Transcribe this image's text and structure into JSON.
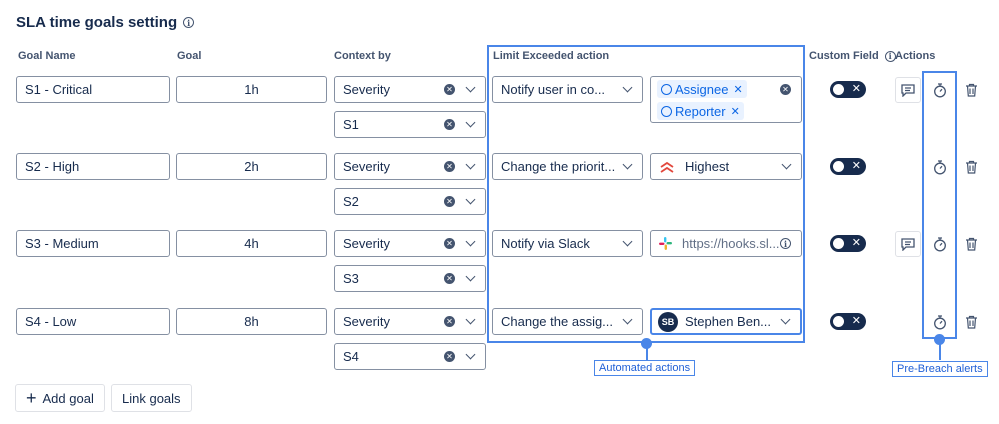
{
  "title": "SLA time goals setting",
  "headers": {
    "goal_name": "Goal Name",
    "goal": "Goal",
    "context_by": "Context by",
    "limit_action": "Limit Exceeded action",
    "custom_field": "Custom Field",
    "actions": "Actions"
  },
  "rows": [
    {
      "name": "S1 - Critical",
      "goal": "1h",
      "context": "Severity",
      "context_value": "S1",
      "action": "Notify user in co...",
      "target_tags": [
        "Assignee",
        "Reporter"
      ],
      "custom_field_on": false,
      "action_icons": [
        "comment-icon",
        "stopwatch-icon",
        "trash-icon"
      ]
    },
    {
      "name": "S2 - High",
      "goal": "2h",
      "context": "Severity",
      "context_value": "S2",
      "action": "Change the priorit...",
      "target": "Highest",
      "target_icon": "priority-highest-icon",
      "custom_field_on": false,
      "action_icons": [
        "stopwatch-icon",
        "trash-icon"
      ]
    },
    {
      "name": "S3 - Medium",
      "goal": "4h",
      "context": "Severity",
      "context_value": "S3",
      "action": "Notify via Slack",
      "target": "https://hooks.sl...",
      "target_icon": "slack-icon",
      "custom_field_on": false,
      "action_icons": [
        "comment-icon",
        "stopwatch-icon",
        "trash-icon"
      ]
    },
    {
      "name": "S4 - Low",
      "goal": "8h",
      "context": "Severity",
      "context_value": "S4",
      "action": "Change the assig...",
      "target": "Stephen Ben...",
      "target_avatar": "SB",
      "custom_field_on": false,
      "action_icons": [
        "stopwatch-icon",
        "trash-icon"
      ]
    }
  ],
  "buttons": {
    "add_goal": "Add goal",
    "link_goals": "Link goals"
  },
  "annotations": {
    "automated_actions": "Automated actions",
    "pre_breach_alerts": "Pre-Breach alerts"
  },
  "colors": {
    "highlight": "#4a86e8",
    "tag_bg": "#e9f2ff",
    "tag_text": "#0c66e4",
    "toggle_bg": "#172b4d",
    "priority_highest": "#e2483d"
  }
}
